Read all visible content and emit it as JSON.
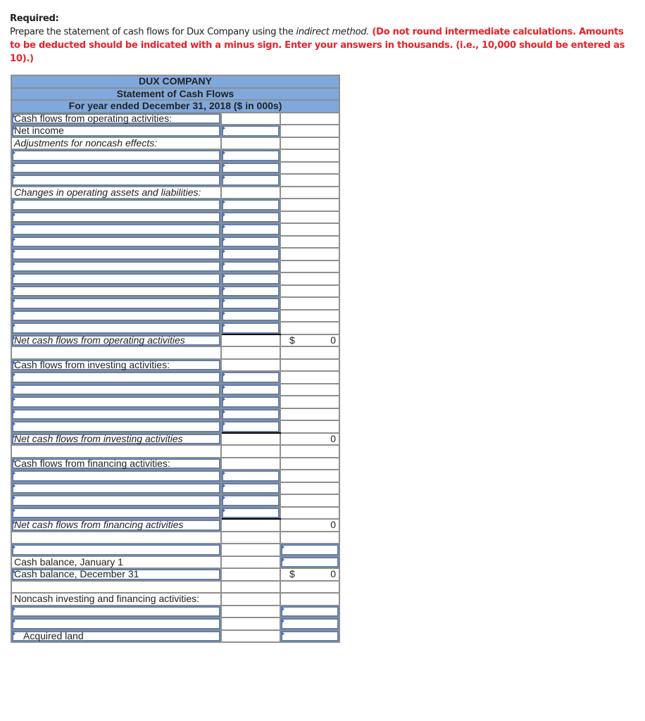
{
  "instructions": {
    "heading": "Required:",
    "text_before_italic": "Prepare the statement of cash flows for Dux Company using the ",
    "italic": "indirect method.",
    "red_note": " (Do not round intermediate calculations. Amounts to be deducted should be indicated with a minus sign. Enter your answers in thousands. (i.e., 10,000 should be entered as 10).)"
  },
  "statement": {
    "company": "DUX COMPANY",
    "title": "Statement of Cash Flows",
    "period": "For year ended December 31, 2018 ($ in 000s)",
    "colors": {
      "header_bg": "#7fa8dc",
      "input_border": "#5f7fae",
      "instruction_red": "#e8232a"
    },
    "labels": {
      "operating_header": "Cash flows from operating activities:",
      "net_income": "Net income",
      "adjustments": "Adjustments for noncash effects:",
      "changes": "Changes in operating assets and liabilities:",
      "net_operating": "Net cash flows from operating activities",
      "investing_header": "Cash flows from investing activities:",
      "net_investing": "Net cash flows from investing activities",
      "financing_header": "Cash flows from financing activities:",
      "net_financing": "Net cash flows from financing activities",
      "cash_jan1": "Cash balance, January 1",
      "cash_dec31": "Cash balance, December 31",
      "noncash_header": "Noncash investing and financing activities:",
      "acquired_land": "Acquired land"
    },
    "totals": {
      "net_operating": {
        "currency": "$",
        "value": "0"
      },
      "net_investing": {
        "value": "0"
      },
      "net_financing": {
        "value": "0"
      },
      "cash_dec31": {
        "currency": "$",
        "value": "0"
      }
    },
    "input_rows": {
      "adjustments": 3,
      "changes": 11,
      "investing": 5,
      "financing": 4,
      "noncash": 2
    }
  }
}
